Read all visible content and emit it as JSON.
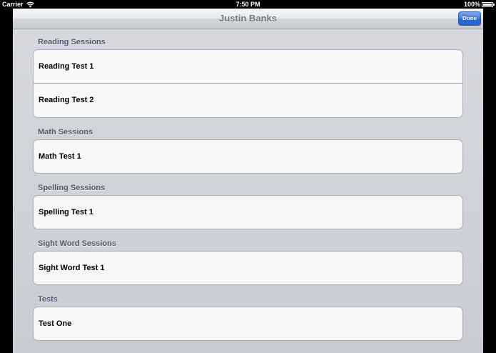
{
  "status_bar": {
    "carrier": "Carrier",
    "time": "7:50 PM",
    "battery": "100%",
    "battery_level": 1.0
  },
  "nav_bar": {
    "title": "Justin Banks",
    "done_label": "Done"
  },
  "sections": [
    {
      "header": "Reading Sessions",
      "items": [
        "Reading Test 1",
        "Reading Test 2"
      ]
    },
    {
      "header": "Math Sessions",
      "items": [
        "Math Test 1"
      ]
    },
    {
      "header": "Spelling Sessions",
      "items": [
        "Spelling Test 1"
      ]
    },
    {
      "header": "Sight Word Sessions",
      "items": [
        "Sight Word Test 1"
      ]
    },
    {
      "header": "Tests",
      "items": [
        "Test One"
      ]
    }
  ],
  "colors": {
    "accent": "#2f68d6",
    "section_header": "#4c566c"
  }
}
